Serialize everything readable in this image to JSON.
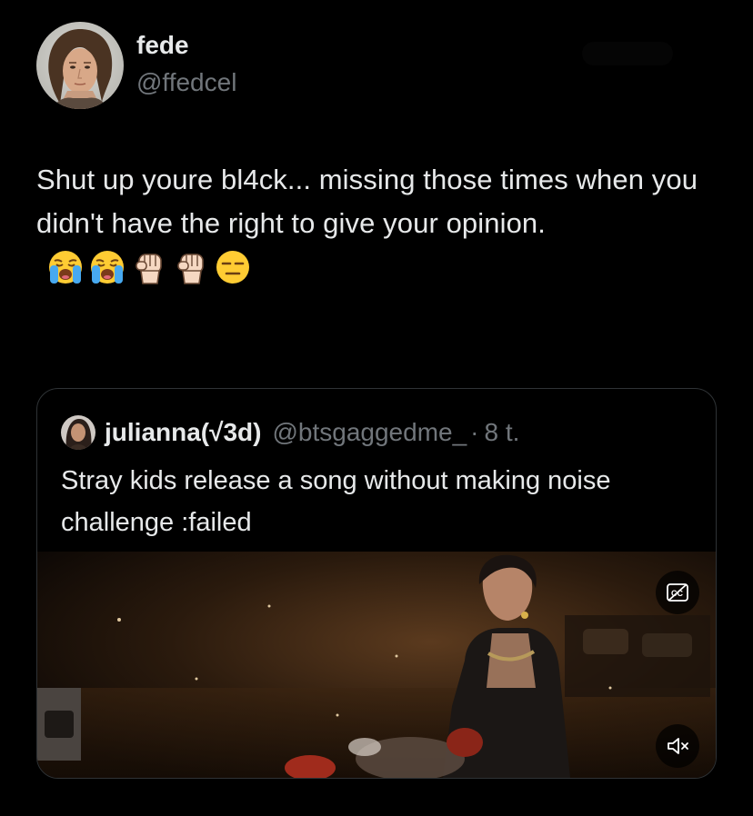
{
  "author": {
    "name": "fede",
    "handle": "@ffedcel"
  },
  "tweet": {
    "text": "Shut up youre bl4ck... missing those times when you didn't have the right to give your opinion.",
    "emojis": [
      "loudly-crying-face",
      "loudly-crying-face",
      "raised-fist",
      "raised-fist",
      "expressionless-face"
    ]
  },
  "quote": {
    "name": "julianna(√3d)",
    "handle": "@btsgaggedme_",
    "separator": "·",
    "time": "8 t.",
    "text": "Stray kids release a song without making noise challenge :failed",
    "media": {
      "type": "video",
      "icons": [
        "closed-captions-off-icon",
        "volume-muted-icon"
      ]
    }
  },
  "colors": {
    "background": "#000000",
    "text_primary": "#e7e9ea",
    "text_secondary": "#71767b",
    "border": "#2f3336"
  }
}
